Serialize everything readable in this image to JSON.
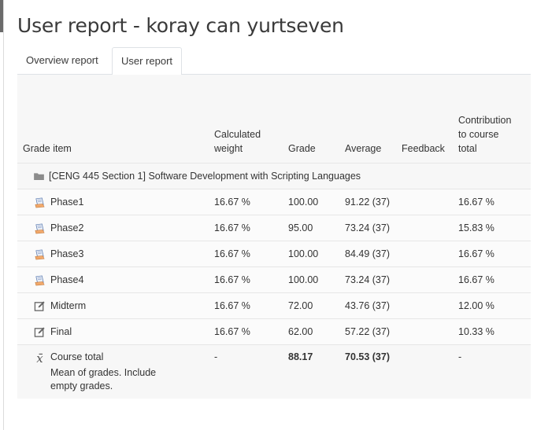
{
  "page": {
    "title": "User report - koray can yurtseven"
  },
  "tabs": [
    {
      "label": "Overview report",
      "active": false
    },
    {
      "label": "User report",
      "active": true
    }
  ],
  "table": {
    "headers": {
      "grade_item": "Grade item",
      "weight": "Calculated\nweight",
      "grade": "Grade",
      "average": "Average",
      "feedback": "Feedback",
      "contribution": "Contribution\nto course\ntotal"
    },
    "category": {
      "name": "[CENG 445 Section 1] Software Development with Scripting Languages",
      "icon": "folder-icon"
    },
    "items": [
      {
        "name": "Phase1",
        "icon": "assignment-icon",
        "weight": "16.67 %",
        "grade": "100.00",
        "average": "91.22 (37)",
        "feedback": "",
        "contribution": "16.67 %"
      },
      {
        "name": "Phase2",
        "icon": "assignment-icon",
        "weight": "16.67 %",
        "grade": "95.00",
        "average": "73.24 (37)",
        "feedback": "",
        "contribution": "15.83 %"
      },
      {
        "name": "Phase3",
        "icon": "assignment-icon",
        "weight": "16.67 %",
        "grade": "100.00",
        "average": "84.49 (37)",
        "feedback": "",
        "contribution": "16.67 %"
      },
      {
        "name": "Phase4",
        "icon": "assignment-icon",
        "weight": "16.67 %",
        "grade": "100.00",
        "average": "73.24 (37)",
        "feedback": "",
        "contribution": "16.67 %"
      },
      {
        "name": "Midterm",
        "icon": "manual-item-icon",
        "weight": "16.67 %",
        "grade": "72.00",
        "average": "43.76 (37)",
        "feedback": "",
        "contribution": "12.00 %"
      },
      {
        "name": "Final",
        "icon": "manual-item-icon",
        "weight": "16.67 %",
        "grade": "62.00",
        "average": "57.22 (37)",
        "feedback": "",
        "contribution": "10.33 %"
      }
    ],
    "total": {
      "name": "Course total",
      "note": "Mean of grades. Include empty grades.",
      "icon": "mean-icon",
      "weight": "-",
      "grade": "88.17",
      "average": "70.53 (37)",
      "feedback": "",
      "contribution": "-"
    }
  },
  "colors": {
    "panel_bg": "#f7f7f7",
    "border": "#dee2e6",
    "text": "#333333"
  }
}
